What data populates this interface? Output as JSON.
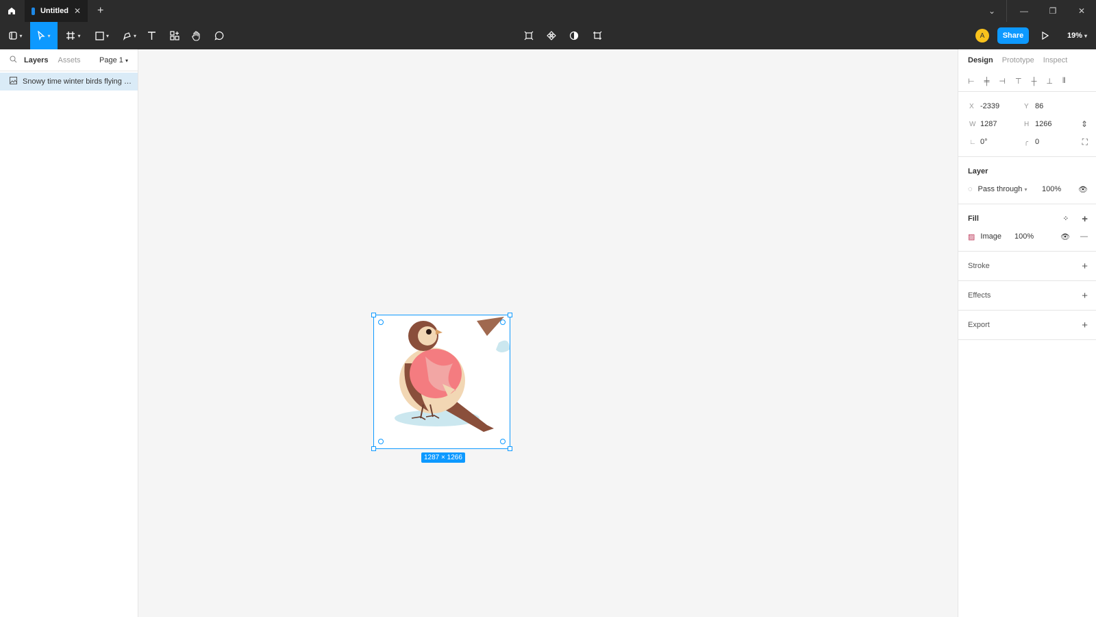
{
  "tab": {
    "title": "Untitled"
  },
  "toolbar": {
    "share_label": "Share",
    "zoom": "19%",
    "avatar_letter": "A"
  },
  "left_panel": {
    "tabs": [
      "Layers",
      "Assets"
    ],
    "page": "Page 1",
    "layers": [
      {
        "name": "Snowy time winter birds flying or h..."
      }
    ]
  },
  "canvas": {
    "dimension_badge": "1287 × 1266"
  },
  "right_panel": {
    "tabs": [
      "Design",
      "Prototype",
      "Inspect"
    ],
    "x": "-2339",
    "y": "86",
    "w": "1287",
    "h": "1266",
    "rotation": "0°",
    "radius": "0",
    "layer": {
      "title": "Layer",
      "blend": "Pass through",
      "opacity": "100%"
    },
    "fill": {
      "title": "Fill",
      "type": "Image",
      "opacity": "100%"
    },
    "stroke": "Stroke",
    "effects": "Effects",
    "export": "Export"
  },
  "help_label": "?"
}
